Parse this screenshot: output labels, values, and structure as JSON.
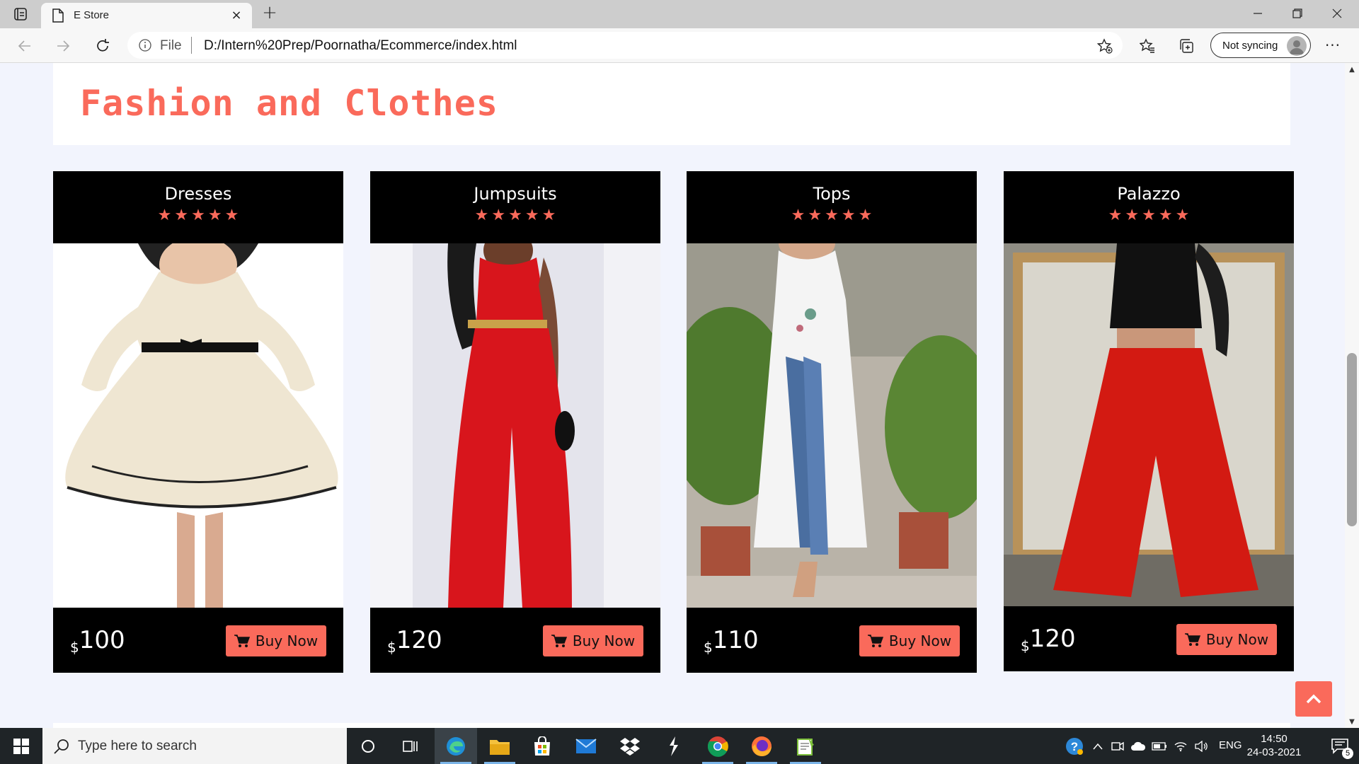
{
  "browser": {
    "tab_title": "E Store",
    "url_scheme": "File",
    "url": "D:/Intern%20Prep/Poornatha/Ecommerce/index.html",
    "sync_label": "Not syncing",
    "new_tab_label": "+",
    "close_tab_label": "×"
  },
  "page": {
    "section_title": "Fashion and Clothes",
    "accent_color": "#fa6a5b",
    "currency": "$",
    "buy_label": "Buy Now",
    "products": [
      {
        "name": "Dresses",
        "rating": 5,
        "price": "100",
        "image": "dress-photo"
      },
      {
        "name": "Jumpsuits",
        "rating": 5,
        "price": "120",
        "image": "jumpsuit-photo"
      },
      {
        "name": "Tops",
        "rating": 5,
        "price": "110",
        "image": "top-photo"
      },
      {
        "name": "Palazzo",
        "rating": 5,
        "price": "120",
        "image": "palazzo-photo"
      }
    ]
  },
  "taskbar": {
    "search_placeholder": "Type here to search",
    "language": "ENG",
    "time": "14:50",
    "date": "24-03-2021",
    "notification_count": "5"
  }
}
